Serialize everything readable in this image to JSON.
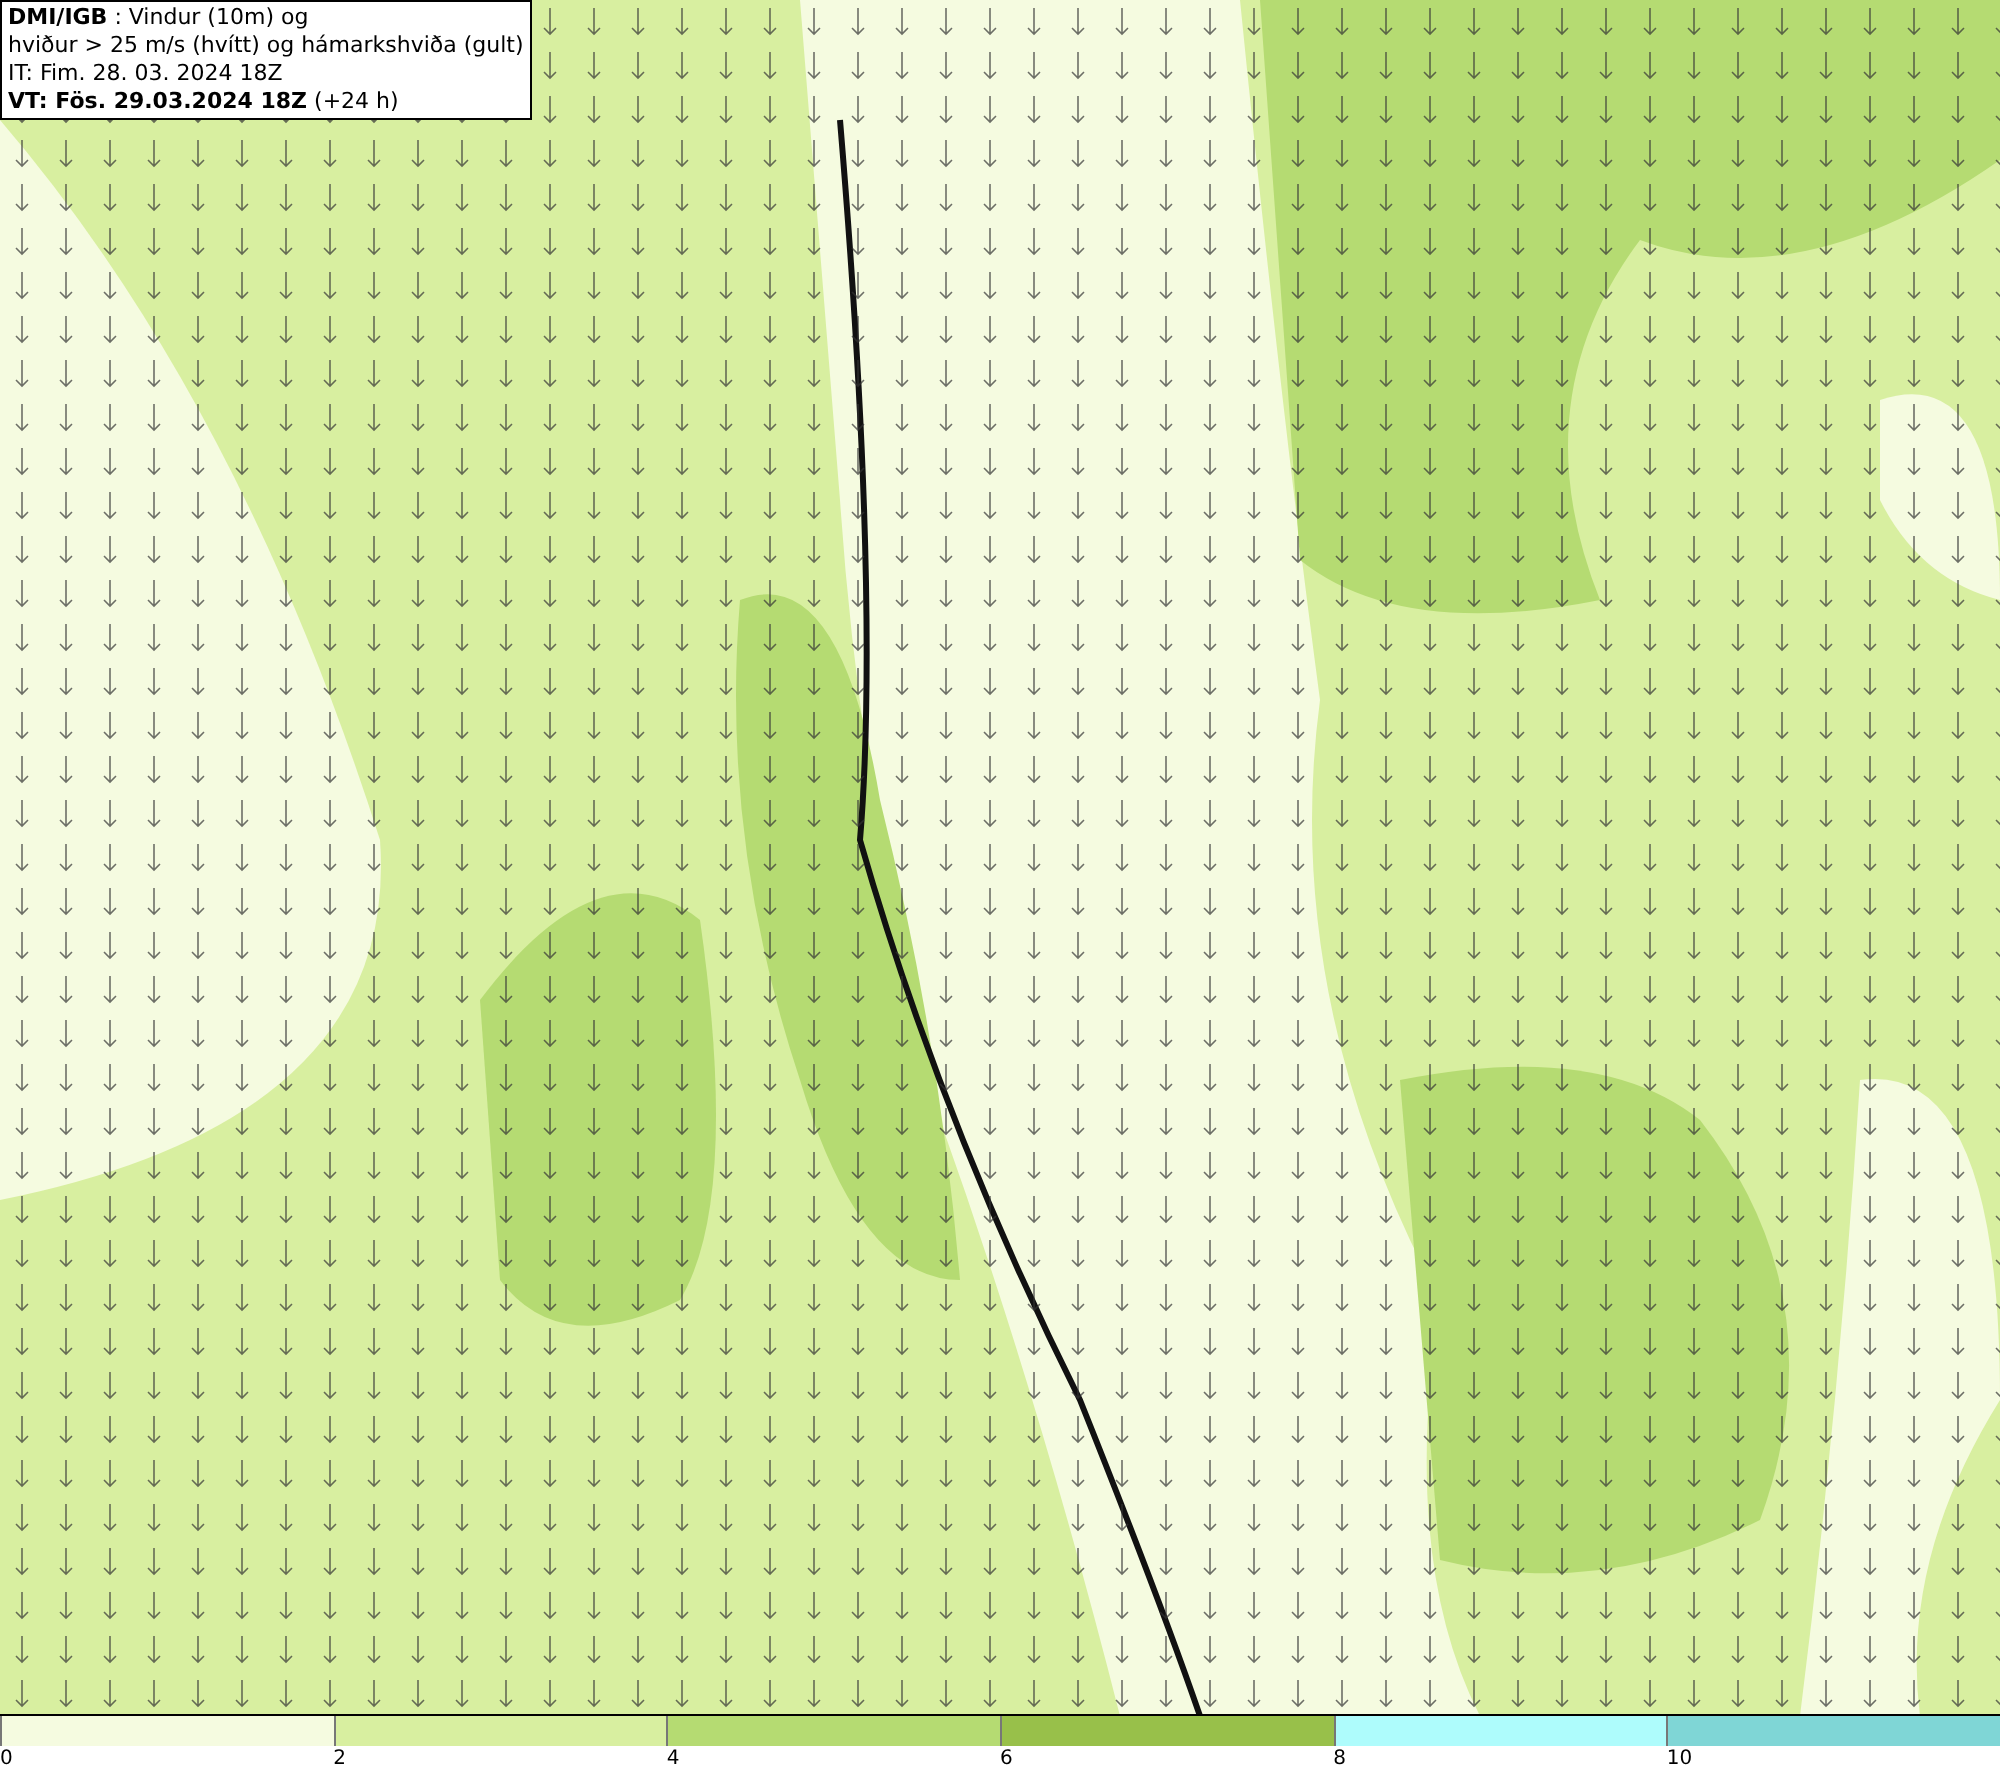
{
  "title_box": {
    "lines": [
      "**DMI/IGB** : Vindur (10m) og",
      "hviður > 25 m/s (hvítt) og hámarkshviða (gult)",
      "IT: Fim. 28. 03. 2024 18Z",
      "**VT: Fös. 29.03.2024 18Z** (+24 h)"
    ]
  },
  "color_scale": [
    {
      "label": "0",
      "color": "#f5fbe0"
    },
    {
      "label": "2",
      "color": "#d8efa0"
    },
    {
      "label": "4",
      "color": "#b5db72"
    },
    {
      "label": "6",
      "color": "#98c04a"
    },
    {
      "label": "8",
      "color": "#aefcfc"
    },
    {
      "label": "10",
      "color": "#7fd6d6"
    }
  ]
}
